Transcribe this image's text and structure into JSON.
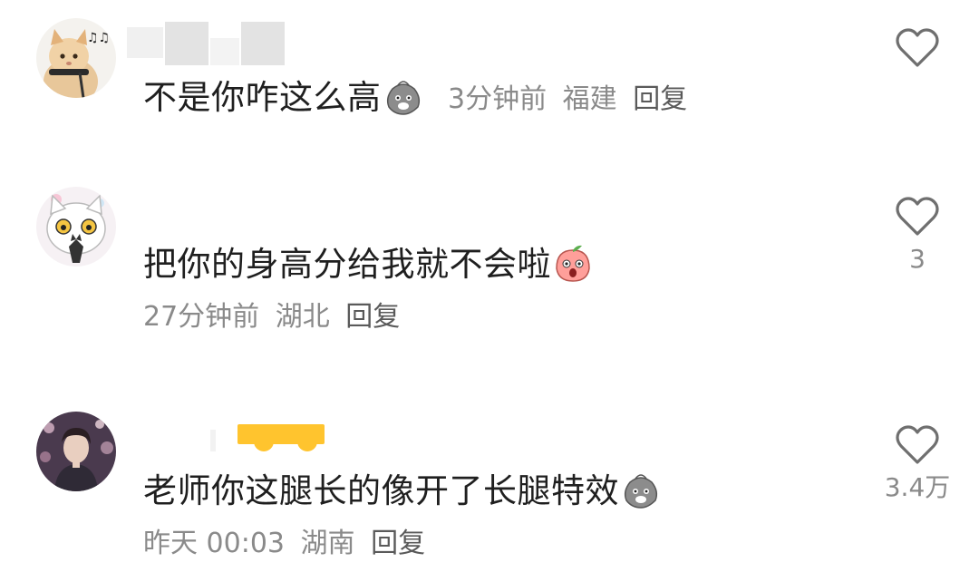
{
  "comments": [
    {
      "avatar": "cat-with-headphones-avatar",
      "text": "不是你咋这么高",
      "emoji": "smug-face-emoji",
      "time": "3分钟前",
      "location": "福建",
      "reply_label": "回复",
      "likes": ""
    },
    {
      "avatar": "cartoon-cat-avatar",
      "text": "把你的身高分给我就不会啦",
      "emoji": "surprised-peach-emoji",
      "time": "27分钟前",
      "location": "湖北",
      "reply_label": "回复",
      "likes": "3"
    },
    {
      "avatar": "concert-photo-avatar",
      "text": "老师你这腿长的像开了长腿特效",
      "emoji": "smug-face-emoji",
      "time": "昨天 00:03",
      "location": "湖南",
      "reply_label": "回复",
      "likes": "3.4万"
    }
  ],
  "colors": {
    "text": "#1f1f1f",
    "meta": "#8a8a8a",
    "heart_outline": "#6f6f6f",
    "mask_gray": "#e6e6e6",
    "mask_yellow": "#ffc42e"
  },
  "icons": {
    "like": "heart-outline-icon"
  }
}
